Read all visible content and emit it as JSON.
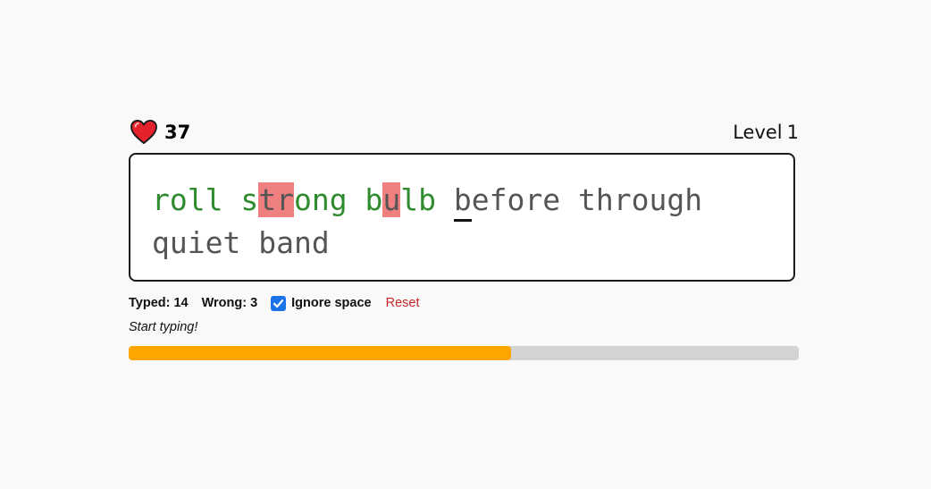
{
  "header": {
    "heart_icon": "heart-icon",
    "lives": "37",
    "level_label": "Level",
    "level_number": "1"
  },
  "text": {
    "chars": [
      {
        "c": "r",
        "s": "correct"
      },
      {
        "c": "o",
        "s": "correct"
      },
      {
        "c": "l",
        "s": "correct"
      },
      {
        "c": "l",
        "s": "correct"
      },
      {
        "c": " ",
        "s": "correct"
      },
      {
        "c": "s",
        "s": "correct"
      },
      {
        "c": "t",
        "s": "wrong"
      },
      {
        "c": "r",
        "s": "wrong"
      },
      {
        "c": "o",
        "s": "correct"
      },
      {
        "c": "n",
        "s": "correct"
      },
      {
        "c": "g",
        "s": "correct"
      },
      {
        "c": " ",
        "s": "correct"
      },
      {
        "c": "b",
        "s": "correct"
      },
      {
        "c": "u",
        "s": "wrong"
      },
      {
        "c": "l",
        "s": "correct"
      },
      {
        "c": "b",
        "s": "correct"
      },
      {
        "c": " ",
        "s": "correct"
      },
      {
        "c": "b",
        "s": "cursor"
      },
      {
        "c": "e",
        "s": "pending"
      },
      {
        "c": "f",
        "s": "pending"
      },
      {
        "c": "o",
        "s": "pending"
      },
      {
        "c": "r",
        "s": "pending"
      },
      {
        "c": "e",
        "s": "pending"
      },
      {
        "c": " ",
        "s": "pending"
      },
      {
        "c": "t",
        "s": "pending"
      },
      {
        "c": "h",
        "s": "pending"
      },
      {
        "c": "r",
        "s": "pending"
      },
      {
        "c": "o",
        "s": "pending"
      },
      {
        "c": "u",
        "s": "pending"
      },
      {
        "c": "g",
        "s": "pending"
      },
      {
        "c": "h",
        "s": "pending"
      },
      {
        "c": " ",
        "s": "pending"
      },
      {
        "c": "q",
        "s": "pending"
      },
      {
        "c": "u",
        "s": "pending"
      },
      {
        "c": "i",
        "s": "pending"
      },
      {
        "c": "e",
        "s": "pending"
      },
      {
        "c": "t",
        "s": "pending"
      },
      {
        "c": " ",
        "s": "pending"
      },
      {
        "c": "b",
        "s": "pending"
      },
      {
        "c": "a",
        "s": "pending"
      },
      {
        "c": "n",
        "s": "pending"
      },
      {
        "c": "d",
        "s": "pending"
      }
    ]
  },
  "stats": {
    "typed_label": "Typed:",
    "typed_value": "14",
    "wrong_label": "Wrong:",
    "wrong_value": "3",
    "ignore_space_label": "Ignore space",
    "ignore_space_checked": true,
    "reset_label": "Reset"
  },
  "status": "Start typing!",
  "progress": {
    "fraction": 0.57
  },
  "colors": {
    "correct": "#2e8b2e",
    "wrong_bg": "#f08080",
    "pending": "#555555",
    "progress_fill": "#ffa500",
    "progress_track": "#d3d3d3",
    "checkbox": "#1a73e8",
    "reset": "#c62828"
  }
}
